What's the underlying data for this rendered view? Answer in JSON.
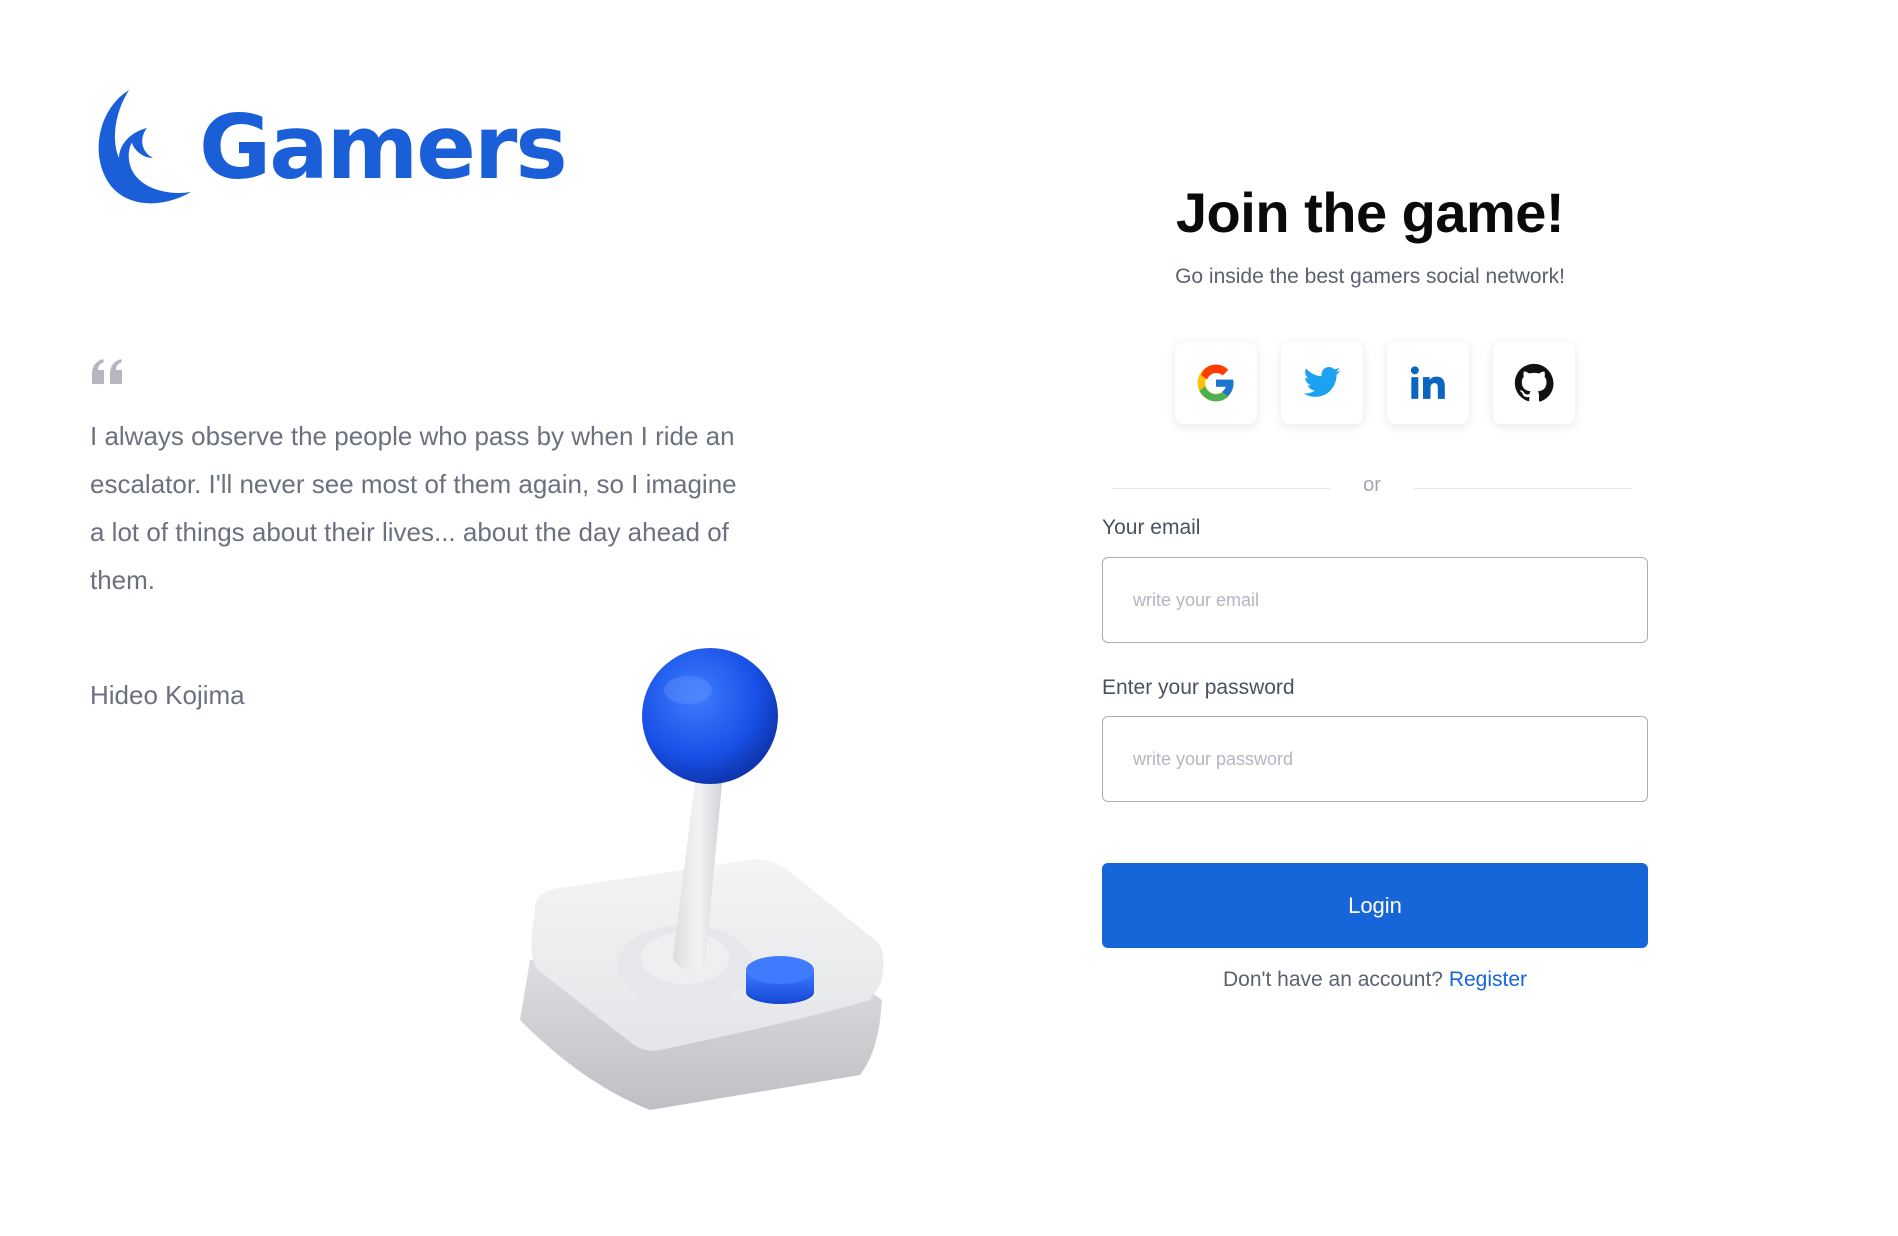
{
  "brand": {
    "name": "Gamers",
    "color": "#1a5fd8"
  },
  "quote": {
    "icon": "quote-icon",
    "text": "I always observe the people who pass by when I ride an escalator. I'll never see most of them again, so I imagine a lot of things about their lives... about the day ahead of them.",
    "author": "Hideo Kojima"
  },
  "illustration": {
    "icon": "joystick-illustration"
  },
  "form": {
    "title": "Join the game!",
    "subtitle": "Go inside the best gamers social network!",
    "social_buttons": [
      {
        "icon": "google-icon"
      },
      {
        "icon": "twitter-icon"
      },
      {
        "icon": "linkedin-icon"
      },
      {
        "icon": "github-icon"
      }
    ],
    "divider_text": "or",
    "email": {
      "label": "Your email",
      "placeholder": "write your email",
      "value": ""
    },
    "password": {
      "label": "Enter your password",
      "placeholder": "write your password",
      "value": ""
    },
    "login_label": "Login",
    "register_prompt": "Don't have an account?",
    "register_link": "Register"
  },
  "colors": {
    "accent": "#1766d9",
    "text_muted": "#6b7180"
  }
}
